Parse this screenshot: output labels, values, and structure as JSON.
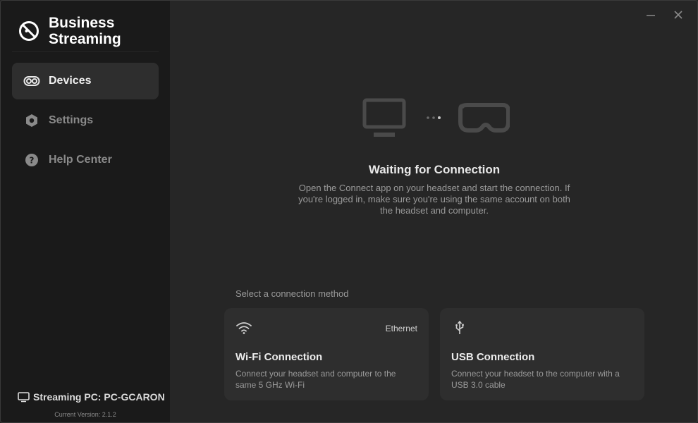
{
  "app": {
    "title": "Business Streaming"
  },
  "sidebar": {
    "items": [
      {
        "label": "Devices",
        "icon": "headset-icon",
        "active": true
      },
      {
        "label": "Settings",
        "icon": "hexagon-gear-icon",
        "active": false
      },
      {
        "label": "Help Center",
        "icon": "question-circle-icon",
        "active": false
      }
    ],
    "footer": {
      "streaming_pc": "Streaming PC: PC-GCARON",
      "version": "Current Version: 2.1.2"
    }
  },
  "main": {
    "status_title": "Waiting for Connection",
    "status_desc": "Open the Connect app on your headset and start the connection. If you're logged in, make sure you're using the same account on both the headset and computer.",
    "method_label": "Select a connection method",
    "methods": [
      {
        "icon": "wifi-icon",
        "tag": "Ethernet",
        "title": "Wi-Fi Connection",
        "desc": "Connect your headset and computer to the same 5 GHz Wi-Fi"
      },
      {
        "icon": "usb-icon",
        "tag": "",
        "title": "USB Connection",
        "desc": "Connect your headset to the computer with a USB 3.0 cable"
      }
    ]
  },
  "colors": {
    "background": "#262626",
    "sidebar": "#1a1a1a",
    "card": "#2e2e2e",
    "active_nav": "#2e2e2e"
  }
}
